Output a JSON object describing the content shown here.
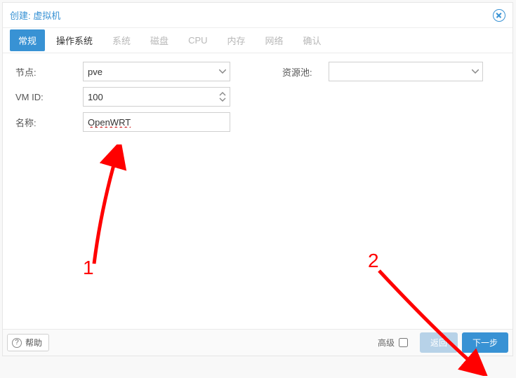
{
  "header": {
    "title": "创建: 虚拟机"
  },
  "tabs": [
    {
      "label": "常规",
      "enabled": true,
      "active": true
    },
    {
      "label": "操作系统",
      "enabled": true,
      "active": false
    },
    {
      "label": "系统",
      "enabled": false,
      "active": false
    },
    {
      "label": "磁盘",
      "enabled": false,
      "active": false
    },
    {
      "label": "CPU",
      "enabled": false,
      "active": false
    },
    {
      "label": "内存",
      "enabled": false,
      "active": false
    },
    {
      "label": "网络",
      "enabled": false,
      "active": false
    },
    {
      "label": "确认",
      "enabled": false,
      "active": false
    }
  ],
  "form": {
    "node": {
      "label": "节点:",
      "value": "pve"
    },
    "vmid": {
      "label": "VM ID:",
      "value": "100"
    },
    "name": {
      "label": "名称:",
      "value": "OpenWRT"
    },
    "pool": {
      "label": "资源池:",
      "value": ""
    }
  },
  "footer": {
    "help": "帮助",
    "advanced": "高级",
    "back": "返回",
    "next": "下一步"
  },
  "annotations": {
    "one": "1",
    "two": "2"
  },
  "colors": {
    "accent": "#3892d4",
    "arrow": "#ff0000"
  }
}
